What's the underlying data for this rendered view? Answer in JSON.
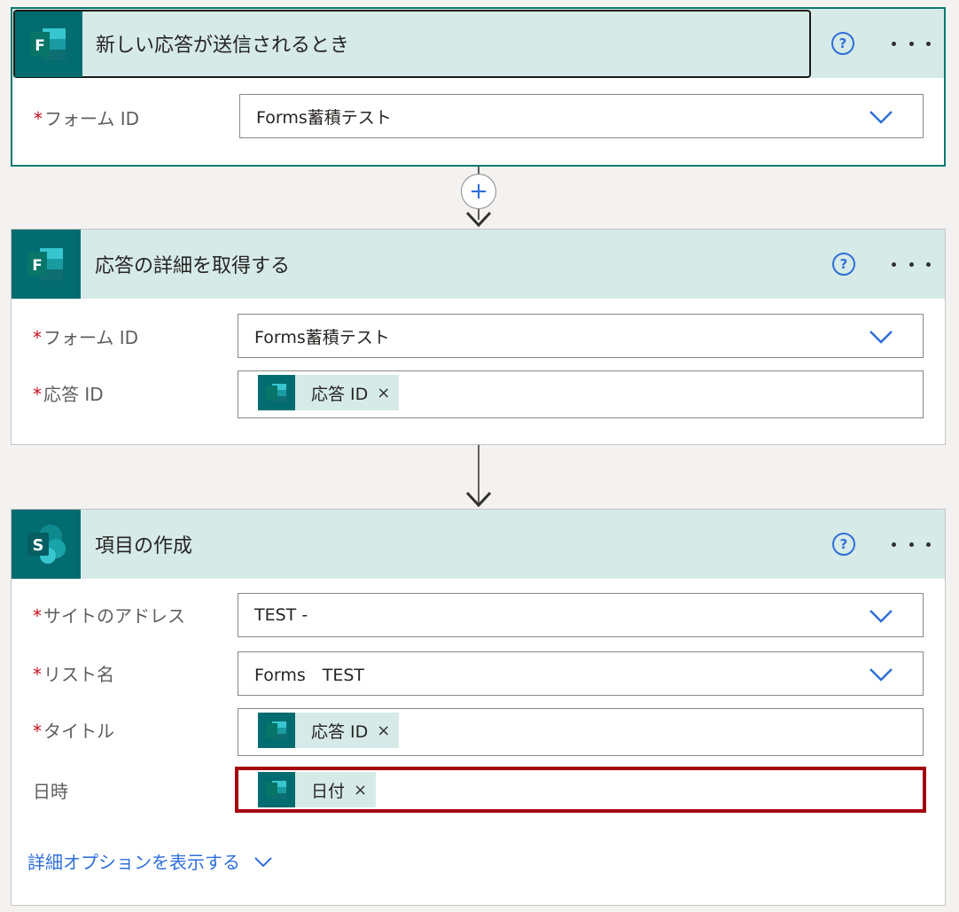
{
  "steps": [
    {
      "title": "新しい応答が送信されるとき",
      "icon": "forms-icon",
      "fields": [
        {
          "label": "フォーム ID",
          "required": true,
          "value": "Forms蓄積テスト",
          "type": "dropdown"
        }
      ]
    },
    {
      "title": "応答の詳細を取得する",
      "icon": "forms-icon",
      "fields": [
        {
          "label": "フォーム ID",
          "required": true,
          "value": "Forms蓄積テスト",
          "type": "dropdown"
        },
        {
          "label": "応答 ID",
          "required": true,
          "token": "応答 ID",
          "type": "token"
        }
      ]
    },
    {
      "title": "項目の作成",
      "icon": "sharepoint-icon",
      "fields": [
        {
          "label": "サイトのアドレス",
          "required": true,
          "value": "TEST -",
          "type": "dropdown"
        },
        {
          "label": "リスト名",
          "required": true,
          "value": "Forms　TEST",
          "type": "dropdown"
        },
        {
          "label": "タイトル",
          "required": true,
          "token": "応答 ID",
          "type": "token"
        },
        {
          "label": "日時",
          "required": false,
          "token": "日付",
          "type": "token",
          "highlighted": true
        }
      ],
      "advanced_link": "詳細オプションを表示する"
    }
  ],
  "required_mark": "*",
  "token_remove": "×",
  "help_glyph": "?",
  "add_step_glyph": "+",
  "colors": {
    "header_bg": "#d6eae8",
    "app_icon_bg": "#036c70",
    "accent_blue": "#2f6fd8",
    "required_red": "#c50f1f",
    "highlight_red": "#a4000f",
    "selected_border": "#0b7a6f"
  }
}
